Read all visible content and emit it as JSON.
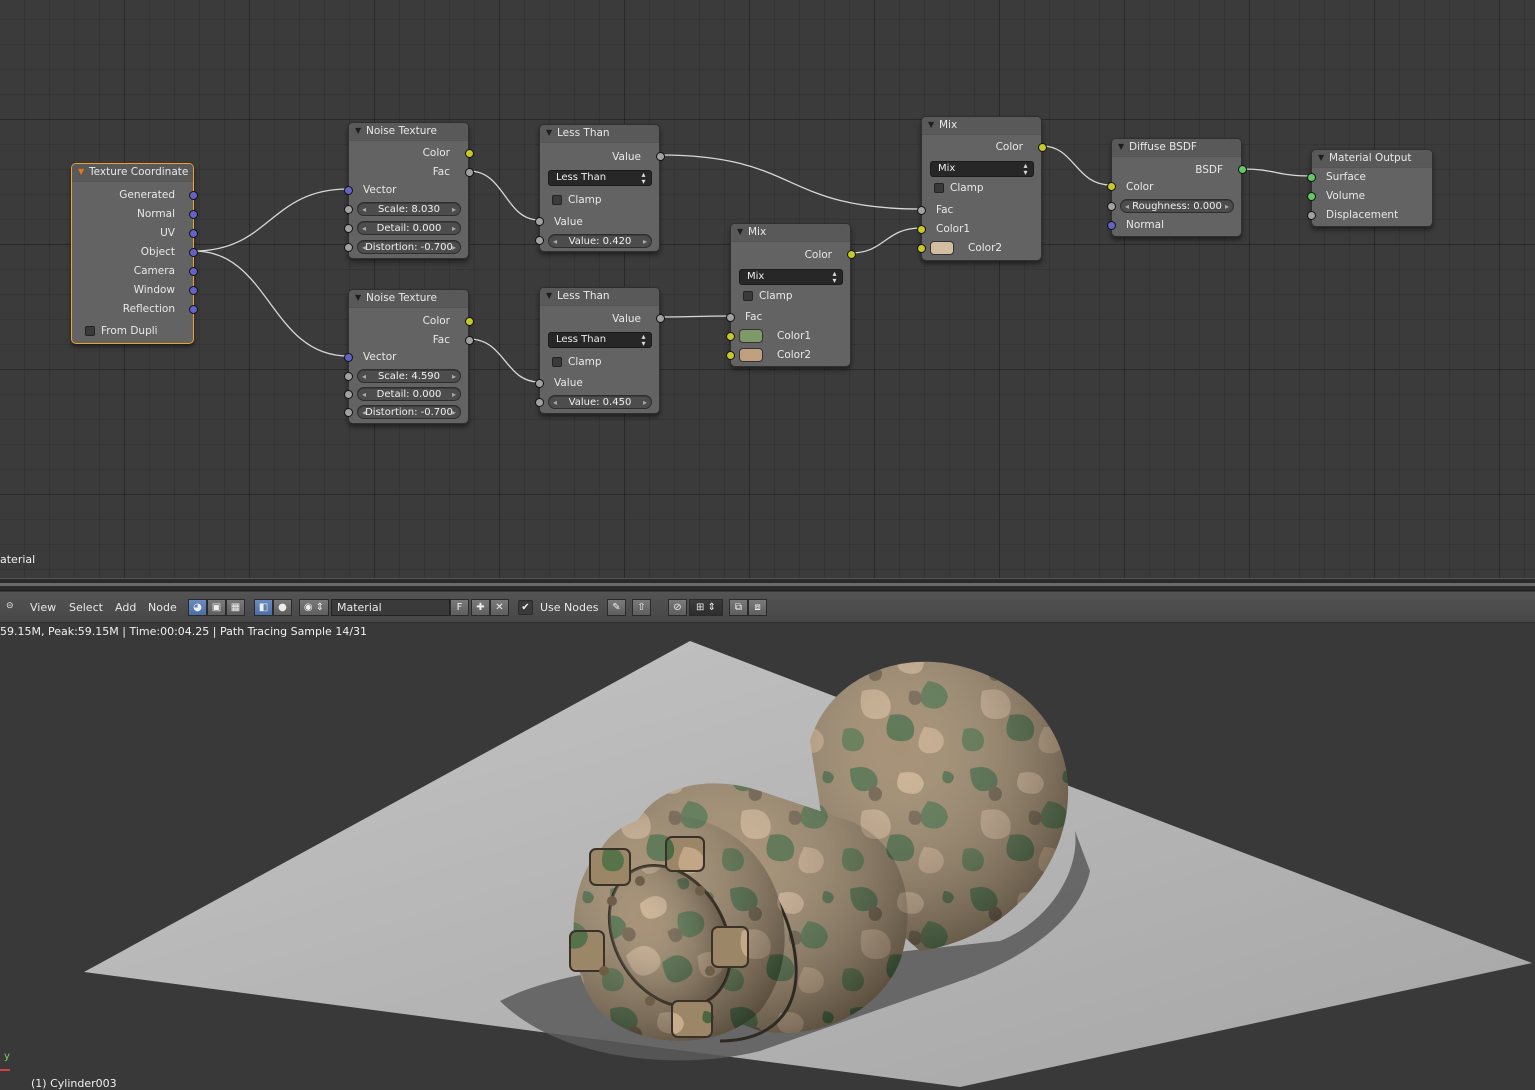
{
  "nodes": {
    "texcoord": {
      "title": "Texture Coordinate",
      "outputs": [
        "Generated",
        "Normal",
        "UV",
        "Object",
        "Camera",
        "Window",
        "Reflection"
      ],
      "checkbox": "From Dupli"
    },
    "noise1": {
      "title": "Noise Texture",
      "out_color": "Color",
      "out_fac": "Fac",
      "in_vector": "Vector",
      "scale": "Scale: 8.030",
      "detail": "Detail: 0.000",
      "distortion": "Distortion: -0.700"
    },
    "noise2": {
      "title": "Noise Texture",
      "out_color": "Color",
      "out_fac": "Fac",
      "in_vector": "Vector",
      "scale": "Scale: 4.590",
      "detail": "Detail: 0.000",
      "distortion": "Distortion: -0.700"
    },
    "lt1": {
      "title": "Less Than",
      "out_value": "Value",
      "operation": "Less Than",
      "clamp": "Clamp",
      "in_value": "Value",
      "value_field": "Value: 0.420"
    },
    "lt2": {
      "title": "Less Than",
      "out_value": "Value",
      "operation": "Less Than",
      "clamp": "Clamp",
      "in_value": "Value",
      "value_field": "Value: 0.450"
    },
    "mix1": {
      "title": "Mix",
      "out_color": "Color",
      "blend": "Mix",
      "clamp": "Clamp",
      "fac": "Fac",
      "color1": "Color1",
      "color2": "Color2",
      "color1_value": "#7e9a68",
      "color2_value": "#c0a07e"
    },
    "mix2": {
      "title": "Mix",
      "out_color": "Color",
      "blend": "Mix",
      "clamp": "Clamp",
      "fac": "Fac",
      "color1": "Color1",
      "color2": "Color2",
      "color2_value": "#d3bf9f"
    },
    "diffuse": {
      "title": "Diffuse BSDF",
      "out_bsdf": "BSDF",
      "in_color": "Color",
      "roughness": "Roughness: 0.000",
      "in_normal": "Normal"
    },
    "output": {
      "title": "Material Output",
      "surface": "Surface",
      "volume": "Volume",
      "displacement": "Displacement"
    }
  },
  "editor_label": "aterial",
  "header": {
    "menus": [
      "View",
      "Select",
      "Add",
      "Node"
    ],
    "material": "Material",
    "fake_user": "F",
    "use_nodes": "Use Nodes"
  },
  "status_text": "59.15M, Peak:59.15M | Time:00:04.25 | Path Tracing Sample 14/31",
  "viewport": {
    "object_label": "(1) Cylinder003",
    "axis_y": "y"
  },
  "colors": {
    "socket_color": "#c7c729",
    "socket_float": "#a1a1a1",
    "socket_vector": "#6363c7",
    "socket_shader": "#63c763",
    "selected_outline": "#f0a030"
  }
}
